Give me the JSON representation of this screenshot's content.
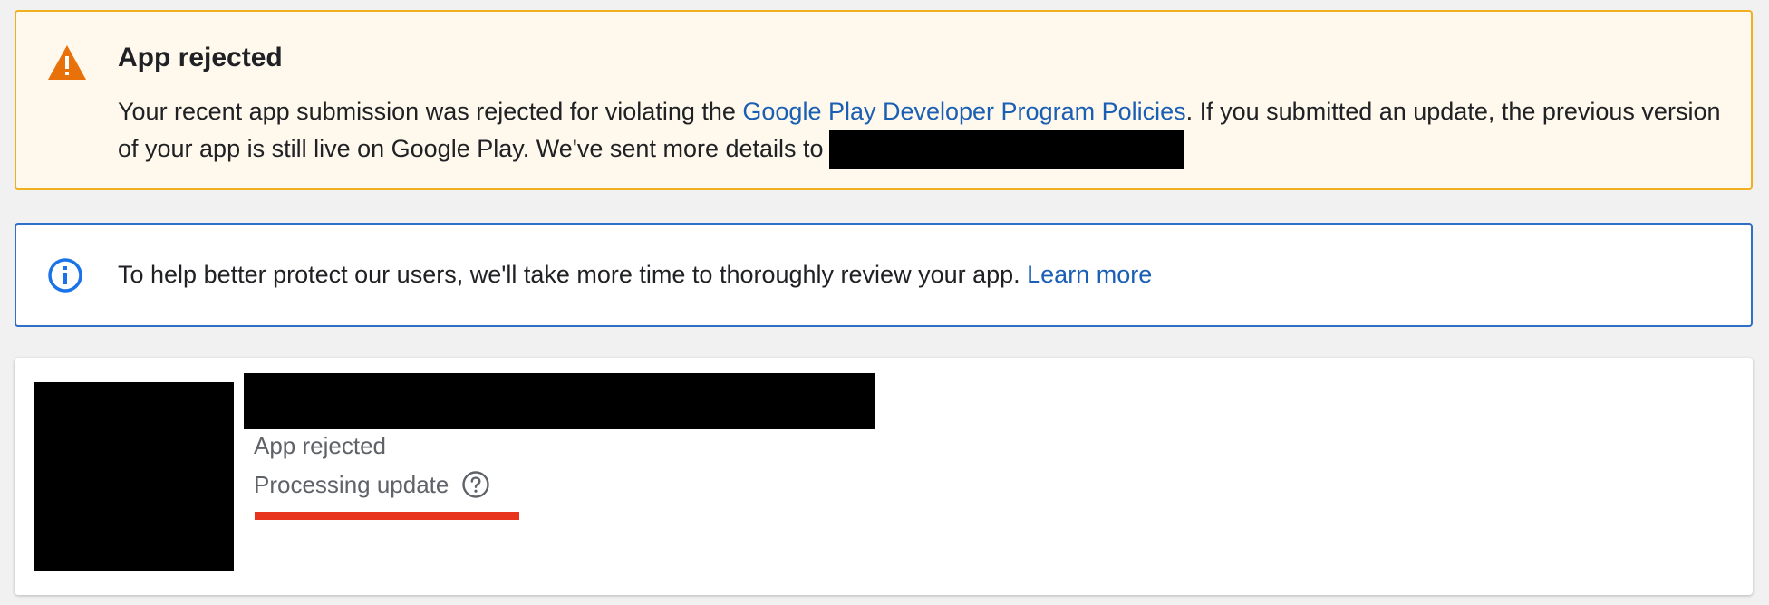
{
  "warning_banner": {
    "title": "App rejected",
    "text_before_link": "Your recent app submission was rejected for violating the ",
    "policy_link": "Google Play Developer Program Policies",
    "text_after_link": ". If you submitted an update, the previous version of your app is still live on Google Play. We've sent more details to",
    "icon": "warning-triangle-icon",
    "background": "#fef9ec",
    "border_color": "#f0b020",
    "icon_color": "#e8710a"
  },
  "info_banner": {
    "text": "To help better protect our users, we'll take more time to thoroughly review your app. ",
    "learn_more_link": "Learn more",
    "icon": "info-circle-icon",
    "border_color": "#2f6fc8",
    "icon_color": "#1a73e8"
  },
  "app_card": {
    "status": "App rejected",
    "processing_label": "Processing update",
    "help_icon": "help-circle-icon",
    "underline_color": "#e8341c"
  }
}
